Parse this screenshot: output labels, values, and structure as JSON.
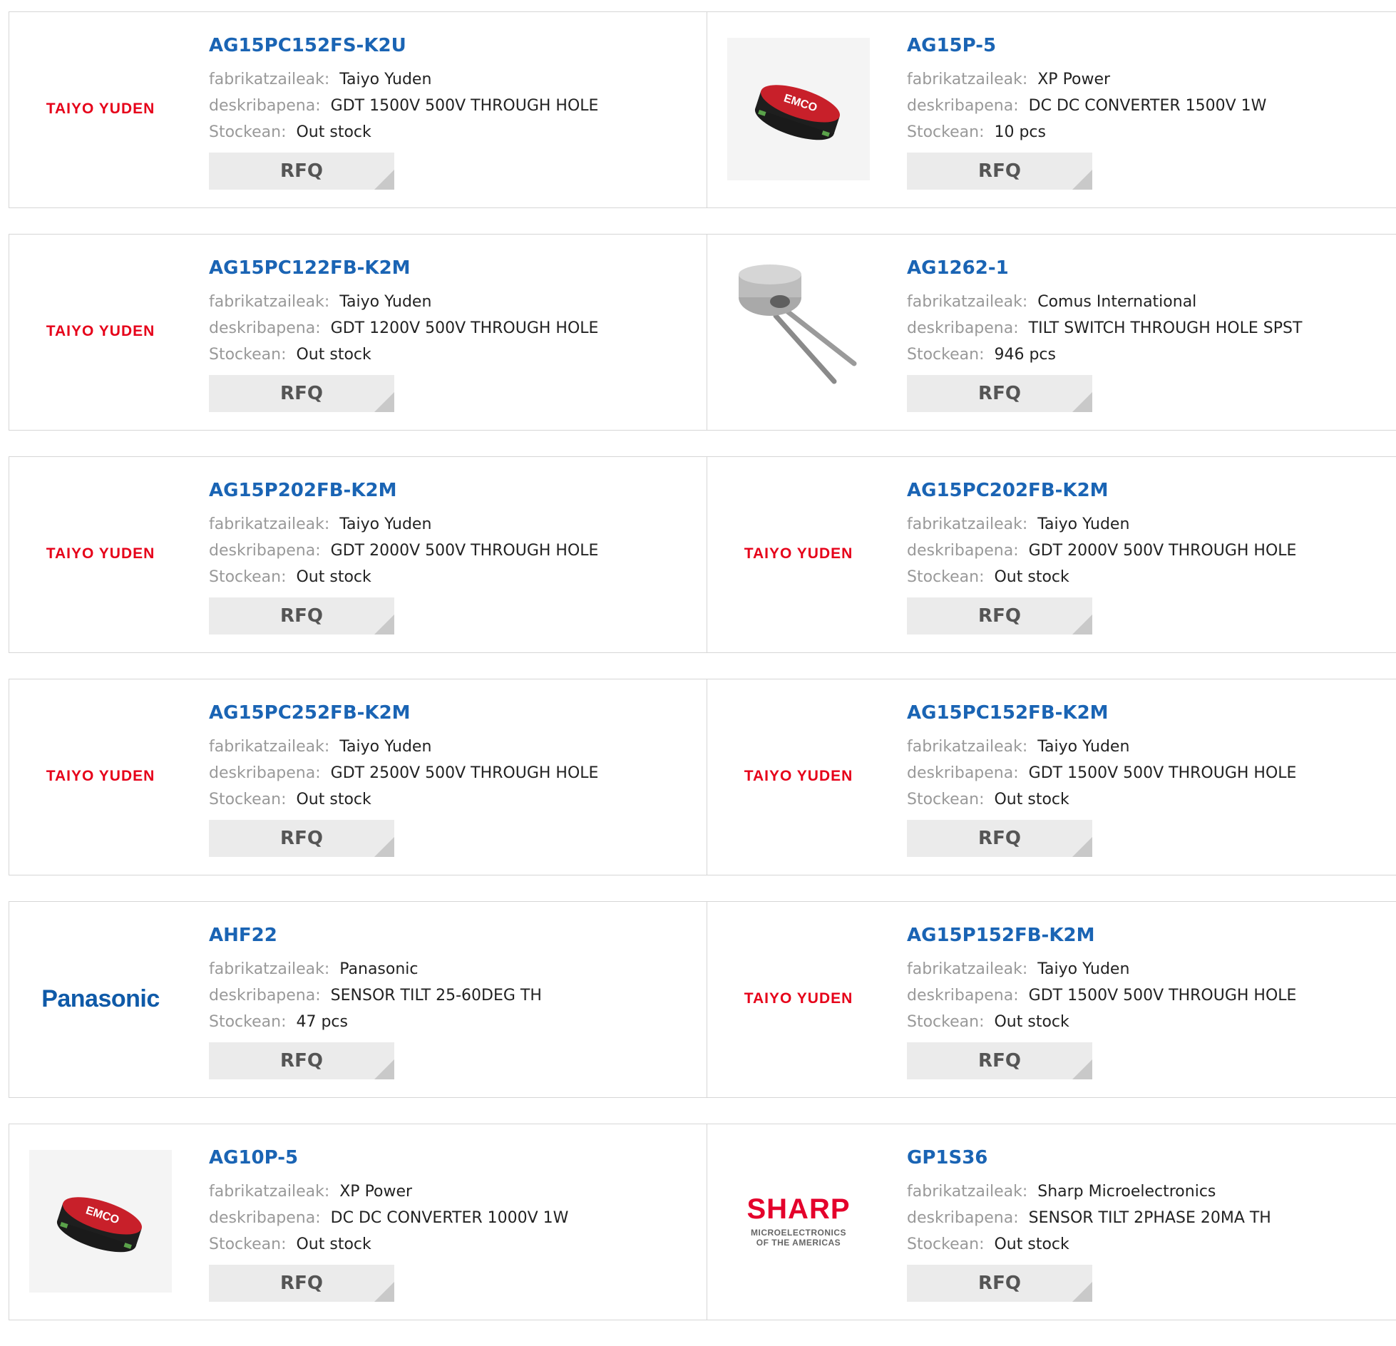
{
  "labels": {
    "manufacturer": "fabrikatzaileak:",
    "description": "deskribapena:",
    "stock": "Stockean:",
    "rfq": "RFQ"
  },
  "logos": {
    "taiyo": "TAIYO YUDEN",
    "panasonic": "Panasonic",
    "sharp_main": "SHARP",
    "sharp_sub1": "MICROELECTRONICS",
    "sharp_sub2": "OF THE AMERICAS",
    "emco": "EMCO"
  },
  "products": [
    {
      "part": "AG15PC152FS-K2U",
      "manufacturer": "Taiyo Yuden",
      "description": "GDT 1500V 500V THROUGH HOLE",
      "stock": "Out stock",
      "image": "taiyo-yuden-logo"
    },
    {
      "part": "AG15P-5",
      "manufacturer": "XP Power",
      "description": "DC DC CONVERTER 1500V 1W",
      "stock": "10 pcs",
      "image": "emco-module-photo"
    },
    {
      "part": "AG15PC122FB-K2M",
      "manufacturer": "Taiyo Yuden",
      "description": "GDT 1200V 500V THROUGH HOLE",
      "stock": "Out stock",
      "image": "taiyo-yuden-logo"
    },
    {
      "part": "AG1262-1",
      "manufacturer": "Comus International",
      "description": "TILT SWITCH THROUGH HOLE SPST",
      "stock": "946 pcs",
      "image": "tilt-switch-photo"
    },
    {
      "part": "AG15P202FB-K2M",
      "manufacturer": "Taiyo Yuden",
      "description": "GDT 2000V 500V THROUGH HOLE",
      "stock": "Out stock",
      "image": "taiyo-yuden-logo"
    },
    {
      "part": "AG15PC202FB-K2M",
      "manufacturer": "Taiyo Yuden",
      "description": "GDT 2000V 500V THROUGH HOLE",
      "stock": "Out stock",
      "image": "taiyo-yuden-logo"
    },
    {
      "part": "AG15PC252FB-K2M",
      "manufacturer": "Taiyo Yuden",
      "description": "GDT 2500V 500V THROUGH HOLE",
      "stock": "Out stock",
      "image": "taiyo-yuden-logo"
    },
    {
      "part": "AG15PC152FB-K2M",
      "manufacturer": "Taiyo Yuden",
      "description": "GDT 1500V 500V THROUGH HOLE",
      "stock": "Out stock",
      "image": "taiyo-yuden-logo"
    },
    {
      "part": "AHF22",
      "manufacturer": "Panasonic",
      "description": "SENSOR TILT 25-60DEG TH",
      "stock": "47 pcs",
      "image": "panasonic-logo"
    },
    {
      "part": "AG15P152FB-K2M",
      "manufacturer": "Taiyo Yuden",
      "description": "GDT 1500V 500V THROUGH HOLE",
      "stock": "Out stock",
      "image": "taiyo-yuden-logo"
    },
    {
      "part": "AG10P-5",
      "manufacturer": "XP Power",
      "description": "DC DC CONVERTER 1000V 1W",
      "stock": "Out stock",
      "image": "emco-module-photo"
    },
    {
      "part": "GP1S36",
      "manufacturer": "Sharp Microelectronics",
      "description": "SENSOR TILT 2PHASE 20MA TH",
      "stock": "Out stock",
      "image": "sharp-logo"
    }
  ],
  "colors": {
    "part_link": "#1a64b4",
    "label": "#999999",
    "value": "#222222",
    "rfq_bg": "#ebebeb",
    "border": "#d6d6d6",
    "taiyo_red": "#e60019",
    "panasonic_blue": "#0f5aa8",
    "sharp_red": "#e4002b"
  }
}
